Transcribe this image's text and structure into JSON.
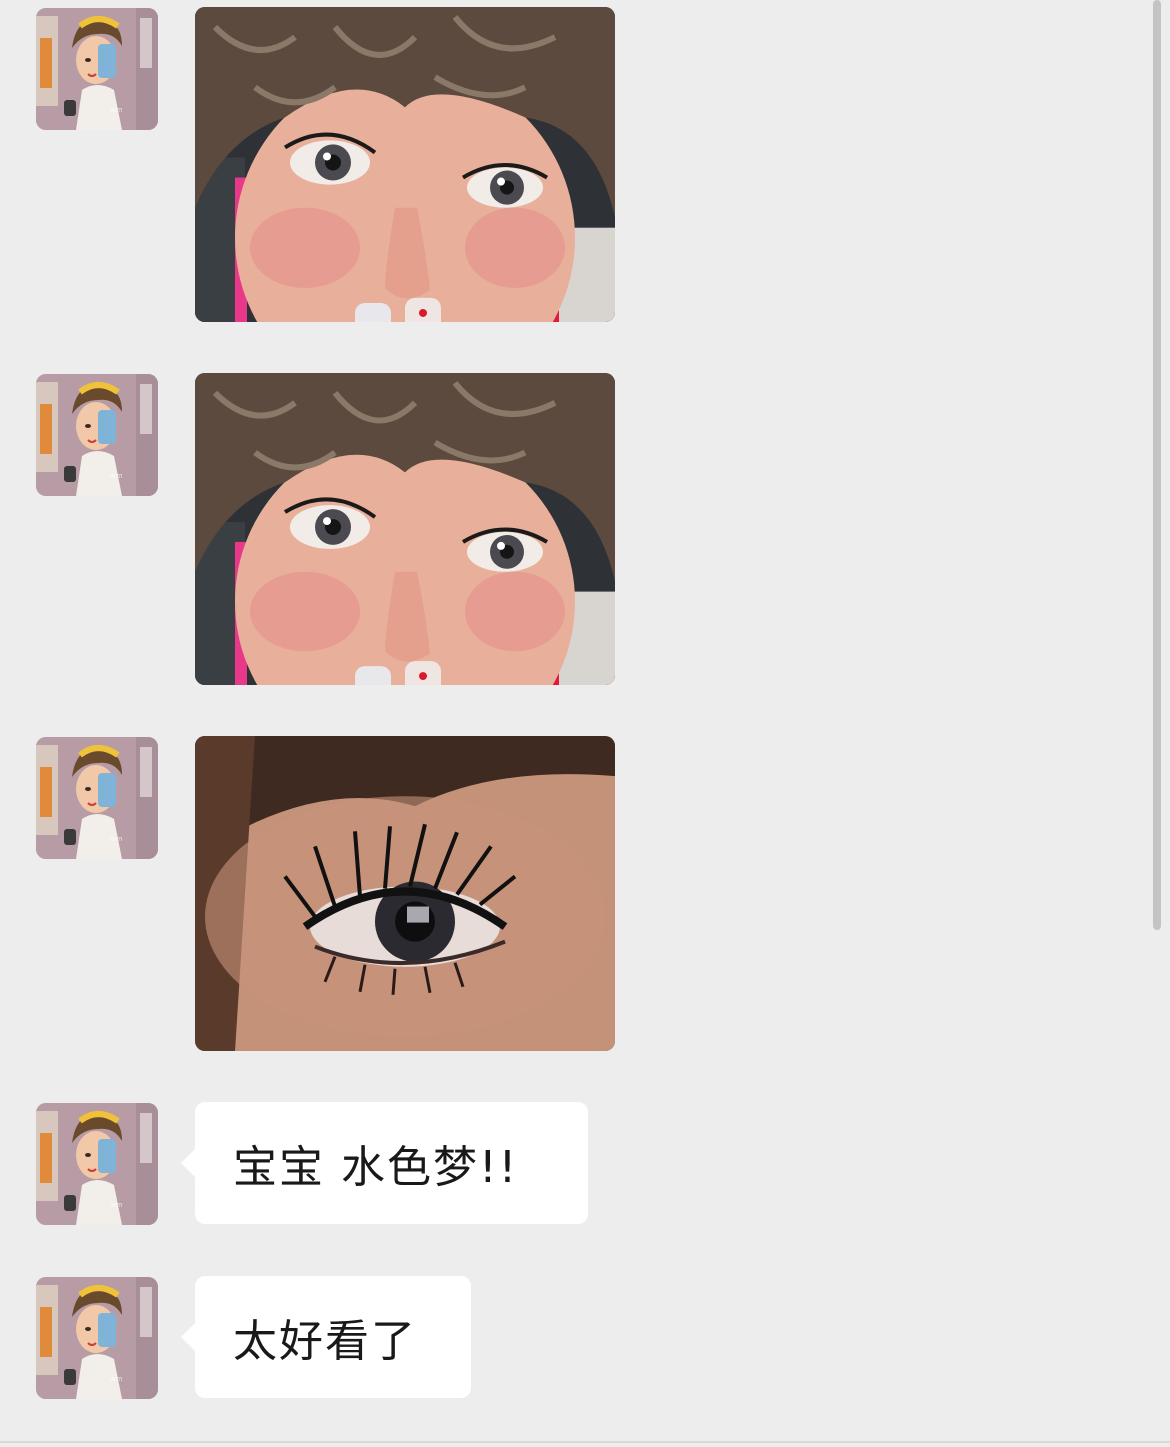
{
  "chat": {
    "messages": [
      {
        "type": "image",
        "sender_avatar": "comic-selfie-avatar",
        "image_subject": "face-close-up"
      },
      {
        "type": "image",
        "sender_avatar": "comic-selfie-avatar",
        "image_subject": "face-close-up"
      },
      {
        "type": "image",
        "sender_avatar": "comic-selfie-avatar",
        "image_subject": "eye-close-up"
      },
      {
        "type": "text",
        "sender_avatar": "comic-selfie-avatar",
        "text": "宝宝 水色梦!!"
      },
      {
        "type": "text",
        "sender_avatar": "comic-selfie-avatar",
        "text": "太好看了"
      }
    ]
  },
  "colors": {
    "background": "#ededed",
    "bubble": "#ffffff",
    "text": "#191919",
    "scrollbar": "#c4c4c4"
  }
}
